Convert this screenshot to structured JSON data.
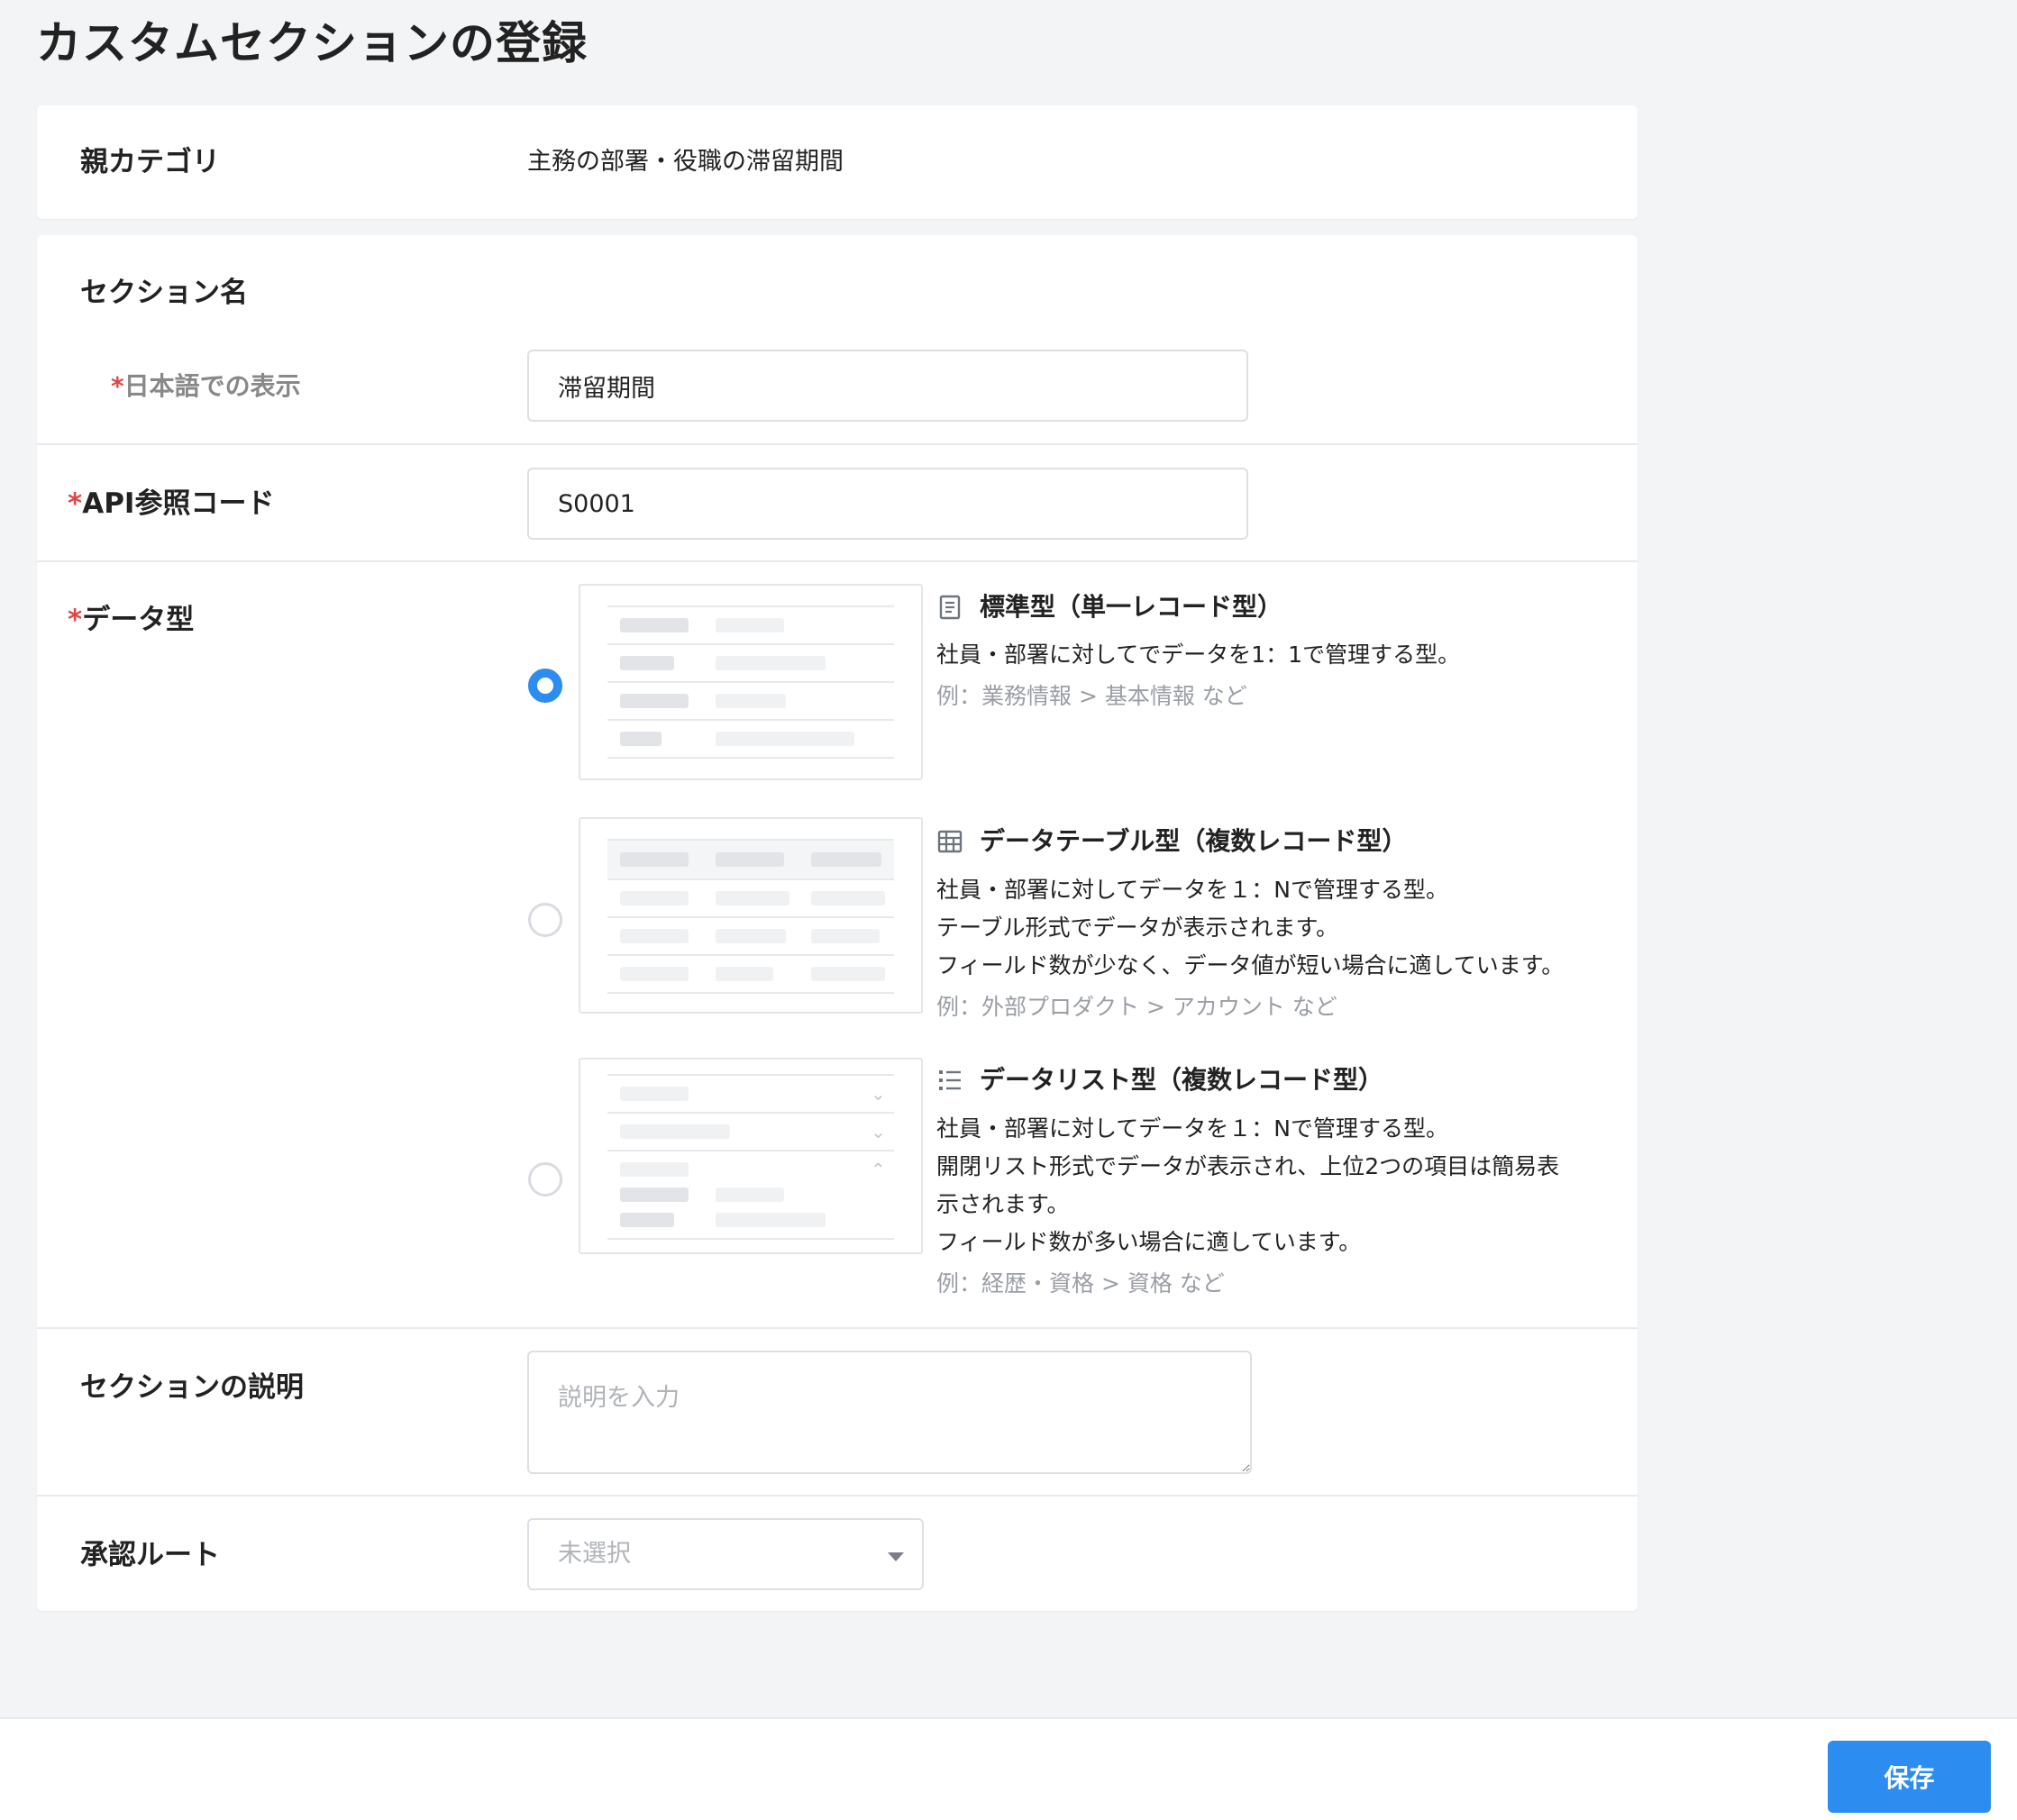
{
  "page": {
    "title": "カスタムセクションの登録"
  },
  "parent_category": {
    "label": "親カテゴリ",
    "value": "主務の部署・役職の滞留期間"
  },
  "section_name": {
    "label": "セクション名",
    "ja_display": {
      "required_mark": "*",
      "label": "日本語での表示",
      "value": "滞留期間"
    }
  },
  "api_code": {
    "required_mark": "*",
    "label": "API参照コード",
    "value": "S0001"
  },
  "data_type": {
    "required_mark": "*",
    "label": "データ型",
    "selected_index": 0,
    "options": [
      {
        "icon": "document-icon",
        "title": "標準型（単一レコード型）",
        "lines": [
          "社員・部署に対してでデータを1：1で管理する型。"
        ],
        "example": "例：業務情報 > 基本情報 など"
      },
      {
        "icon": "table-icon",
        "title": "データテーブル型（複数レコード型）",
        "lines": [
          "社員・部署に対してデータを１：Nで管理する型。",
          "テーブル形式でデータが表示されます。",
          "フィールド数が少なく、データ値が短い場合に適しています。"
        ],
        "example": "例：外部プロダクト > アカウント など"
      },
      {
        "icon": "list-icon",
        "title": "データリスト型（複数レコード型）",
        "lines": [
          "社員・部署に対してデータを１：Nで管理する型。",
          "開閉リスト形式でデータが表示され、上位2つの項目は簡易表",
          "示されます。",
          "フィールド数が多い場合に適しています。"
        ],
        "example": "例：経歴・資格 > 資格 など"
      }
    ]
  },
  "description": {
    "label": "セクションの説明",
    "value": "",
    "placeholder": "説明を入力"
  },
  "approval_route": {
    "label": "承認ルート",
    "selected": "未選択"
  },
  "footer": {
    "save_label": "保存"
  },
  "colors": {
    "accent": "#2d8cf0",
    "required": "#e04646",
    "background": "#f3f4f6"
  }
}
